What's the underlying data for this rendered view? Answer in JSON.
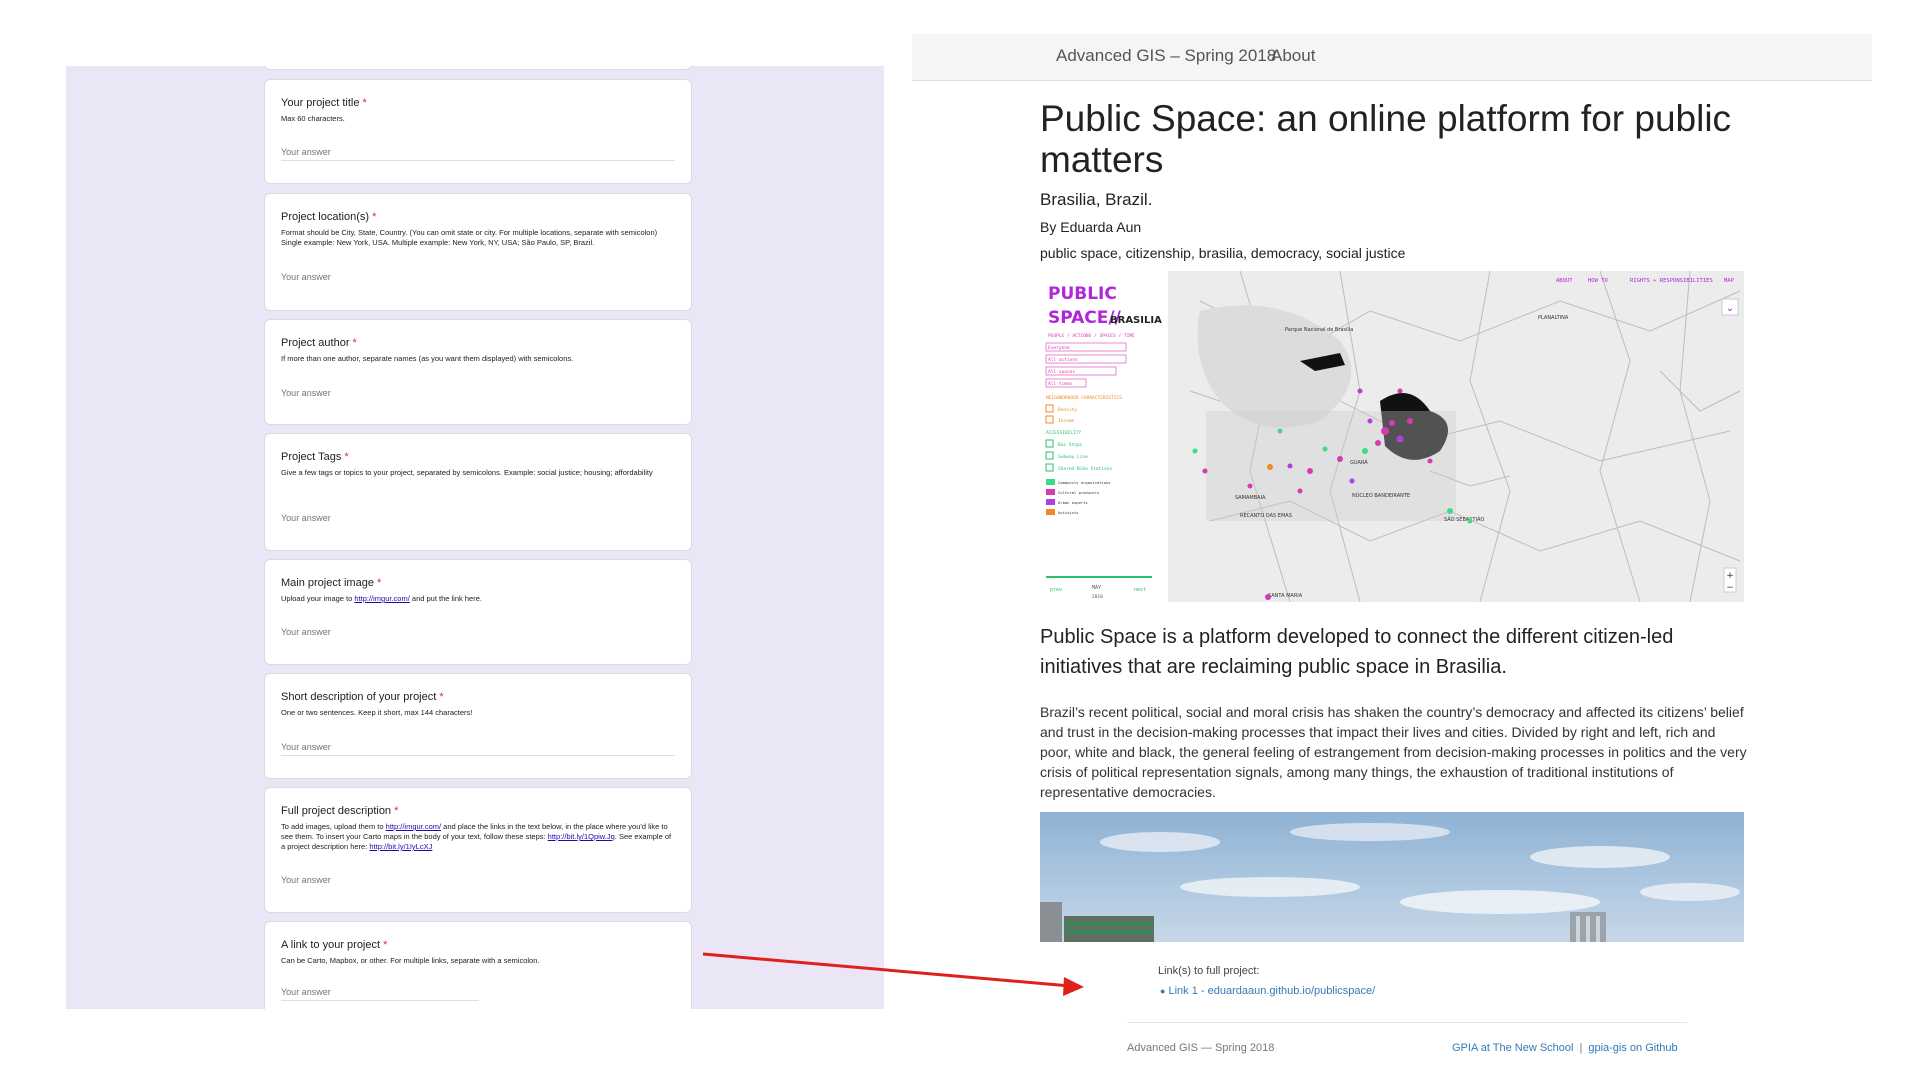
{
  "form": {
    "questions": [
      {
        "title": "Your project title",
        "description": "Max 60 characters.",
        "placeholder": "Your answer"
      },
      {
        "title": "Project location(s)",
        "description": "Format should be City, State, Country. (You can omit state or city. For multiple locations, separate with semicolon) Single example: New York, USA. Multiple example: New York, NY, USA; São Paulo, SP, Brazil.",
        "placeholder": "Your answer"
      },
      {
        "title": "Project author",
        "description": "If more than one author, separate names (as you want them displayed) with semicolons.",
        "placeholder": "Your answer"
      },
      {
        "title": "Project Tags",
        "description": "Give a few tags or topics to your project, separated by semicolons. Example: social justice; housing; affordability",
        "placeholder": "Your answer"
      },
      {
        "title": "Main project image",
        "description_pre": "Upload your image to ",
        "description_link": "http://imgur.com/",
        "description_post": " and put the link here.",
        "placeholder": "Your answer"
      },
      {
        "title": "Short description of your project",
        "description": "One or two sentences. Keep it short, max 144 characters!",
        "placeholder": "Your answer"
      },
      {
        "title": "Full project description",
        "description_a": "To add images, upload them to ",
        "link_a": "http://imgur.com/",
        "description_b": " and place the links in the text below, in the place where you'd like to see them. To insert your Carto maps in the body of your text, follow these steps: ",
        "link_b": "http://bit.ly/1Qpiw.Jq",
        "description_c": ". See example of a project description here: ",
        "link_c": "http://bit.ly/1IyLcXJ",
        "placeholder": "Your answer"
      },
      {
        "title": "A link to your project",
        "description": "Can be Carto, Mapbox, or other. For multiple links, separate with a semicolon.",
        "placeholder": "Your answer"
      }
    ],
    "required_mark": "*"
  },
  "site": {
    "nav": {
      "brand": "Advanced GIS – Spring 2018",
      "about": "About"
    },
    "title": "Public Space: an online platform for public matters",
    "location": "Brasilia, Brazil.",
    "author": "By Eduarda Aun",
    "tags": "public space, citizenship, brasilia, democracy, social justice",
    "map": {
      "logo_line1": "PUBLIC",
      "logo_line2": "SPACE//",
      "logo_city": "BRASILIA",
      "subtitle": "PEOPLE / ACTIONS / SPACES / TIME",
      "filters": [
        "Everyone",
        "All actions",
        "All spaces",
        "All times"
      ],
      "section_neighborhood": "NEIGHBORHOOD CHARACTERISTICS",
      "neighborhood_items": [
        "Density",
        "Income"
      ],
      "section_accessibility": "ACCESSIBILITY",
      "accessibility_items": [
        "Bus Stops",
        "Subway Line",
        "Shared Bike Stations"
      ],
      "legend": [
        {
          "label": "Community organizations",
          "color": "#3ddc84"
        },
        {
          "label": "Cultural producers",
          "color": "#d63ab0"
        },
        {
          "label": "Urban experts",
          "color": "#b040e0"
        },
        {
          "label": "Activists",
          "color": "#f08a24"
        }
      ],
      "timeline_prev": "prev",
      "timeline_month": "MAY",
      "timeline_year": "2018",
      "timeline_next": "next",
      "top_links": [
        "ABOUT",
        "HOW TO",
        "RIGHTS + RESPONSIBILITIES",
        "MAP"
      ],
      "place_labels": [
        "Parque Nacional de Brasília",
        "PLANALTINA",
        "GUARÁ",
        "SAMAMBAIA",
        "RECANTO DAS EMAS",
        "SÃO SEBASTIÃO",
        "SANTA MARIA",
        "NÚCLEO BANDEIRANTE"
      ]
    },
    "lead": "Public Space is a platform developed to connect the different citizen-led initiatives that are reclaiming public space in Brasilia.",
    "body": "Brazil’s recent political, social and moral crisis has shaken the country’s democracy and affected its citizens’ belief and trust in the decision-making processes that impact their lives and cities. Divided by right and left, rich and poor, white and black, the general feeling of estrangement from decision-making processes in politics and the very crisis of political representation signals, among many things, the exhaustion of traditional institutions of representative democracies.",
    "links_label": "Link(s) to full project:",
    "link_1": "Link 1 - eduardaaun.github.io/publicspace/",
    "footer": {
      "left": "Advanced GIS — Spring 2018",
      "right_1": "GPIA at The New School",
      "separator": "|",
      "right_2": "gpia-gis on Github"
    }
  },
  "colors": {
    "form_bg": "#ebe6f6",
    "required": "#d93025",
    "link": "#337ab7",
    "arrow": "#e0201a",
    "map_accent": "#b026d8"
  }
}
